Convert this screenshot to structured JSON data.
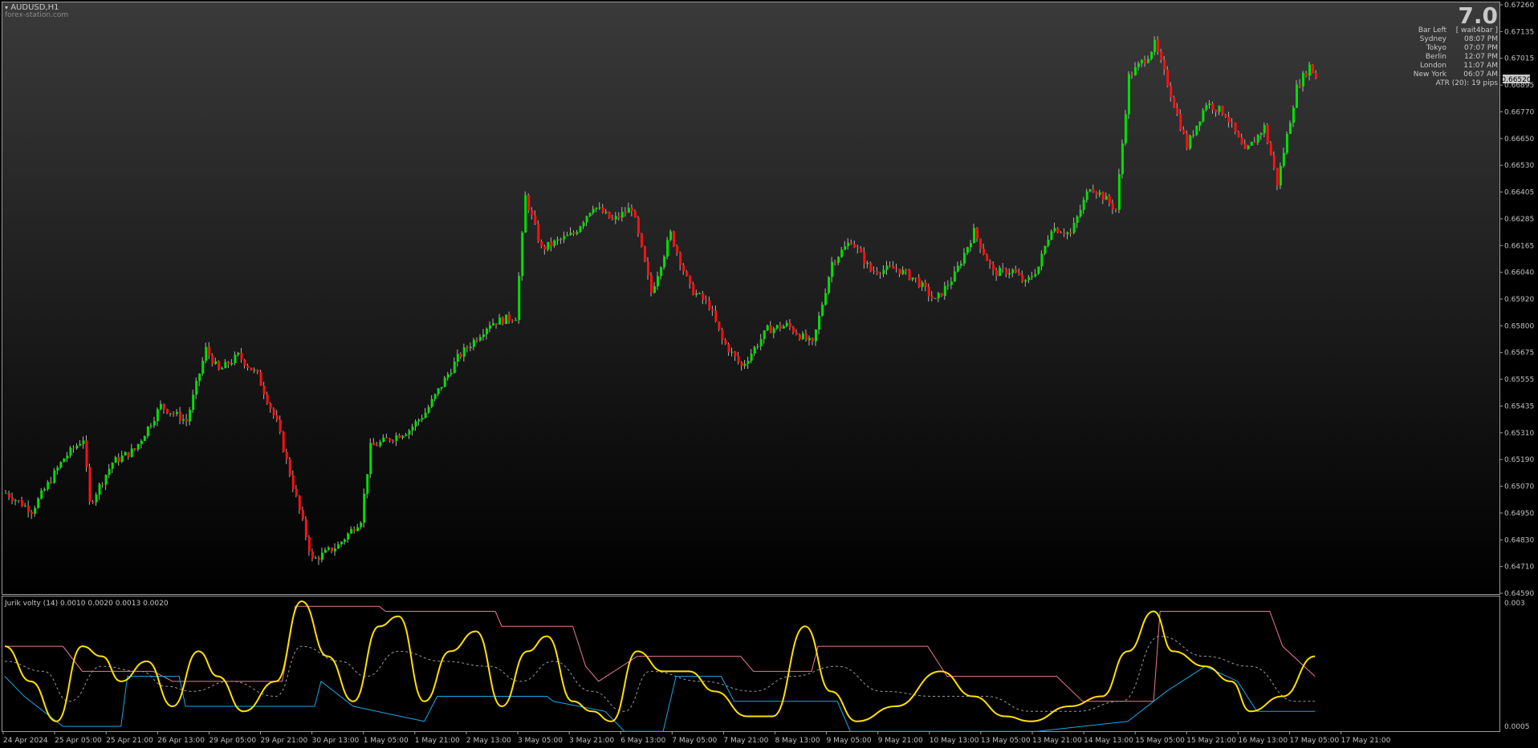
{
  "window": {
    "symbol_label": "AUDUSD,H1",
    "watermark": "forex-station.com"
  },
  "info_panel": {
    "big_value": "7.0",
    "rows": [
      {
        "label": "Bar Left",
        "value": "[ wait4bar ]"
      },
      {
        "label": "Sydney",
        "value": "08:07 PM"
      },
      {
        "label": "Tokyo",
        "value": "07:07 PM"
      },
      {
        "label": "Berlin",
        "value": "12:07 PM"
      },
      {
        "label": "London",
        "value": "11:07 AM"
      },
      {
        "label": "New York",
        "value": "06:07 AM"
      }
    ],
    "atr": "ATR (20): 19 pips"
  },
  "colors": {
    "background_top": "#3a3a3a",
    "background_bottom": "#000000",
    "bull": "#00e000",
    "bear": "#ff1010",
    "yellow": "#ffe000",
    "blue": "#18a8e8",
    "pink": "#e87a90",
    "dashed": "#9a9a9a",
    "axis_text": "#c0c0c0",
    "price_tag": "#c8c8c8"
  },
  "chart_data": [
    {
      "type": "candlestick",
      "title": "AUDUSD,H1",
      "price_tag": "0.66520",
      "yticks": [
        "0.67260",
        "0.67135",
        "0.67015",
        "0.66895",
        "0.66770",
        "0.66650",
        "0.66530",
        "0.66405",
        "0.66285",
        "0.66165",
        "0.66040",
        "0.65920",
        "0.65800",
        "0.65675",
        "0.65555",
        "0.65435",
        "0.65310",
        "0.65190",
        "0.65070",
        "0.64950",
        "0.64830",
        "0.64710",
        "0.64590"
      ],
      "ylim": [
        0.6458,
        0.6728
      ],
      "anchors": [
        {
          "i": 0,
          "p": 0.6504
        },
        {
          "i": 8,
          "p": 0.6496
        },
        {
          "i": 18,
          "p": 0.652
        },
        {
          "i": 24,
          "p": 0.6529
        },
        {
          "i": 26,
          "p": 0.6499
        },
        {
          "i": 33,
          "p": 0.6518
        },
        {
          "i": 40,
          "p": 0.6524
        },
        {
          "i": 48,
          "p": 0.6544
        },
        {
          "i": 56,
          "p": 0.6537
        },
        {
          "i": 62,
          "p": 0.657
        },
        {
          "i": 66,
          "p": 0.656
        },
        {
          "i": 72,
          "p": 0.6567
        },
        {
          "i": 78,
          "p": 0.6558
        },
        {
          "i": 84,
          "p": 0.6536
        },
        {
          "i": 88,
          "p": 0.6513
        },
        {
          "i": 95,
          "p": 0.6473
        },
        {
          "i": 103,
          "p": 0.648
        },
        {
          "i": 110,
          "p": 0.6492
        },
        {
          "i": 113,
          "p": 0.6525
        },
        {
          "i": 125,
          "p": 0.6533
        },
        {
          "i": 130,
          "p": 0.6541
        },
        {
          "i": 140,
          "p": 0.6566
        },
        {
          "i": 150,
          "p": 0.6582
        },
        {
          "i": 158,
          "p": 0.6585
        },
        {
          "i": 161,
          "p": 0.664
        },
        {
          "i": 166,
          "p": 0.6616
        },
        {
          "i": 176,
          "p": 0.6623
        },
        {
          "i": 182,
          "p": 0.6636
        },
        {
          "i": 188,
          "p": 0.6629
        },
        {
          "i": 194,
          "p": 0.6635
        },
        {
          "i": 200,
          "p": 0.6596
        },
        {
          "i": 206,
          "p": 0.6623
        },
        {
          "i": 212,
          "p": 0.6598
        },
        {
          "i": 218,
          "p": 0.659
        },
        {
          "i": 222,
          "p": 0.6574
        },
        {
          "i": 228,
          "p": 0.6562
        },
        {
          "i": 236,
          "p": 0.6579
        },
        {
          "i": 242,
          "p": 0.6581
        },
        {
          "i": 250,
          "p": 0.6572
        },
        {
          "i": 256,
          "p": 0.661
        },
        {
          "i": 262,
          "p": 0.662
        },
        {
          "i": 268,
          "p": 0.6606
        },
        {
          "i": 276,
          "p": 0.6607
        },
        {
          "i": 282,
          "p": 0.6602
        },
        {
          "i": 288,
          "p": 0.6592
        },
        {
          "i": 294,
          "p": 0.6604
        },
        {
          "i": 300,
          "p": 0.6624
        },
        {
          "i": 306,
          "p": 0.6605
        },
        {
          "i": 312,
          "p": 0.6606
        },
        {
          "i": 316,
          "p": 0.66
        },
        {
          "i": 320,
          "p": 0.6608
        },
        {
          "i": 324,
          "p": 0.6626
        },
        {
          "i": 330,
          "p": 0.6623
        },
        {
          "i": 336,
          "p": 0.6645
        },
        {
          "i": 340,
          "p": 0.664
        },
        {
          "i": 344,
          "p": 0.6634
        },
        {
          "i": 348,
          "p": 0.6695
        },
        {
          "i": 354,
          "p": 0.6705
        },
        {
          "i": 356,
          "p": 0.671
        },
        {
          "i": 360,
          "p": 0.6692
        },
        {
          "i": 366,
          "p": 0.6663
        },
        {
          "i": 372,
          "p": 0.6683
        },
        {
          "i": 378,
          "p": 0.6678
        },
        {
          "i": 384,
          "p": 0.666
        },
        {
          "i": 390,
          "p": 0.6672
        },
        {
          "i": 394,
          "p": 0.6646
        },
        {
          "i": 400,
          "p": 0.669
        },
        {
          "i": 404,
          "p": 0.67
        },
        {
          "i": 406,
          "p": 0.6695
        }
      ],
      "n_bars": 407,
      "x_ticks": [
        "24 Apr 2024",
        "25 Apr 05:00",
        "25 Apr 21:00",
        "26 Apr 13:00",
        "29 Apr 05:00",
        "29 Apr 21:00",
        "30 Apr 13:00",
        "1 May 05:00",
        "1 May 21:00",
        "2 May 13:00",
        "3 May 05:00",
        "3 May 21:00",
        "6 May 13:00",
        "7 May 05:00",
        "7 May 21:00",
        "8 May 13:00",
        "9 May 05:00",
        "9 May 21:00",
        "10 May 13:00",
        "13 May 05:00",
        "13 May 21:00",
        "14 May 13:00",
        "15 May 05:00",
        "15 May 21:00",
        "16 May 13:00",
        "17 May 05:00",
        "17 May 21:00"
      ]
    },
    {
      "type": "line",
      "title": "Jurik volty (14) 0.0010 0.0020 0.0013 0.0020",
      "yticks": [
        "0.003",
        "0.0005"
      ],
      "ylim": [
        0.0005,
        0.003
      ],
      "series": [
        {
          "key": "yellow",
          "anchors": [
            [
              0,
              0.0021
            ],
            [
              8,
              0.0014
            ],
            [
              16,
              0.0006
            ],
            [
              24,
              0.0021
            ],
            [
              30,
              0.0019
            ],
            [
              36,
              0.0014
            ],
            [
              44,
              0.0018
            ],
            [
              52,
              0.0009
            ],
            [
              60,
              0.002
            ],
            [
              66,
              0.0015
            ],
            [
              74,
              0.0008
            ],
            [
              84,
              0.0014
            ],
            [
              92,
              0.003
            ],
            [
              100,
              0.0019
            ],
            [
              108,
              0.001
            ],
            [
              116,
              0.0025
            ],
            [
              122,
              0.0027
            ],
            [
              130,
              0.001
            ],
            [
              138,
              0.002
            ],
            [
              146,
              0.0024
            ],
            [
              154,
              0.0009
            ],
            [
              162,
              0.002
            ],
            [
              168,
              0.0023
            ],
            [
              176,
              0.001
            ],
            [
              182,
              0.0008
            ],
            [
              188,
              0.0006
            ],
            [
              196,
              0.002
            ],
            [
              204,
              0.0016
            ],
            [
              212,
              0.0016
            ],
            [
              220,
              0.0012
            ],
            [
              230,
              0.0007
            ],
            [
              238,
              0.0007
            ],
            [
              248,
              0.0025
            ],
            [
              256,
              0.0012
            ],
            [
              264,
              0.0006
            ],
            [
              276,
              0.0009
            ],
            [
              290,
              0.0016
            ],
            [
              300,
              0.0011
            ],
            [
              310,
              0.0007
            ],
            [
              318,
              0.0006
            ],
            [
              330,
              0.0009
            ],
            [
              340,
              0.0011
            ],
            [
              348,
              0.002
            ],
            [
              356,
              0.0028
            ],
            [
              362,
              0.002
            ],
            [
              372,
              0.0017
            ],
            [
              380,
              0.0014
            ],
            [
              386,
              0.0008
            ],
            [
              396,
              0.0011
            ],
            [
              406,
              0.0019
            ]
          ]
        },
        {
          "key": "blue",
          "anchors": [
            [
              0,
              0.0015
            ],
            [
              6,
              0.0011
            ],
            [
              18,
              0.0005
            ],
            [
              36,
              0.0005
            ],
            [
              38,
              0.0015
            ],
            [
              54,
              0.0015
            ],
            [
              56,
              0.0009
            ],
            [
              96,
              0.0009
            ],
            [
              98,
              0.0014
            ],
            [
              108,
              0.0009
            ],
            [
              130,
              0.0006
            ],
            [
              134,
              0.0011
            ],
            [
              168,
              0.0011
            ],
            [
              170,
              0.001
            ],
            [
              186,
              0.0008
            ],
            [
              192,
              0.0003
            ],
            [
              204,
              0.0003
            ],
            [
              208,
              0.0015
            ],
            [
              222,
              0.0015
            ],
            [
              226,
              0.001
            ],
            [
              258,
              0.001
            ],
            [
              262,
              0.0002
            ],
            [
              296,
              0.0003
            ],
            [
              320,
              0.0004
            ],
            [
              348,
              0.0006
            ],
            [
              360,
              0.0012
            ],
            [
              372,
              0.0017
            ],
            [
              382,
              0.0014
            ],
            [
              388,
              0.0008
            ],
            [
              406,
              0.0008
            ]
          ]
        },
        {
          "key": "pink",
          "anchors": [
            [
              0,
              0.0021
            ],
            [
              18,
              0.0021
            ],
            [
              24,
              0.0016
            ],
            [
              46,
              0.0016
            ],
            [
              52,
              0.0014
            ],
            [
              86,
              0.0014
            ],
            [
              90,
              0.0029
            ],
            [
              116,
              0.0029
            ],
            [
              118,
              0.0028
            ],
            [
              152,
              0.0028
            ],
            [
              154,
              0.0025
            ],
            [
              176,
              0.0025
            ],
            [
              180,
              0.0017
            ],
            [
              184,
              0.0014
            ],
            [
              196,
              0.0019
            ],
            [
              228,
              0.0019
            ],
            [
              232,
              0.0016
            ],
            [
              250,
              0.0016
            ],
            [
              252,
              0.0021
            ],
            [
              286,
              0.0021
            ],
            [
              292,
              0.0015
            ],
            [
              326,
              0.0015
            ],
            [
              334,
              0.001
            ],
            [
              356,
              0.001
            ],
            [
              358,
              0.0028
            ],
            [
              392,
              0.0028
            ],
            [
              396,
              0.0021
            ],
            [
              406,
              0.0015
            ]
          ]
        },
        {
          "key": "dashed",
          "anchors": [
            [
              0,
              0.0018
            ],
            [
              12,
              0.0016
            ],
            [
              20,
              0.001
            ],
            [
              30,
              0.0017
            ],
            [
              42,
              0.0016
            ],
            [
              50,
              0.0013
            ],
            [
              58,
              0.0012
            ],
            [
              70,
              0.0014
            ],
            [
              84,
              0.0011
            ],
            [
              92,
              0.0021
            ],
            [
              104,
              0.0018
            ],
            [
              112,
              0.0015
            ],
            [
              122,
              0.002
            ],
            [
              136,
              0.0018
            ],
            [
              150,
              0.0017
            ],
            [
              160,
              0.0014
            ],
            [
              170,
              0.0018
            ],
            [
              182,
              0.0012
            ],
            [
              192,
              0.0008
            ],
            [
              200,
              0.0016
            ],
            [
              216,
              0.0014
            ],
            [
              232,
              0.0012
            ],
            [
              244,
              0.0015
            ],
            [
              258,
              0.0017
            ],
            [
              272,
              0.0012
            ],
            [
              288,
              0.0011
            ],
            [
              304,
              0.0011
            ],
            [
              318,
              0.0008
            ],
            [
              332,
              0.0008
            ],
            [
              346,
              0.001
            ],
            [
              358,
              0.0023
            ],
            [
              372,
              0.0019
            ],
            [
              386,
              0.0017
            ],
            [
              400,
              0.001
            ],
            [
              406,
              0.001
            ]
          ]
        }
      ]
    }
  ]
}
